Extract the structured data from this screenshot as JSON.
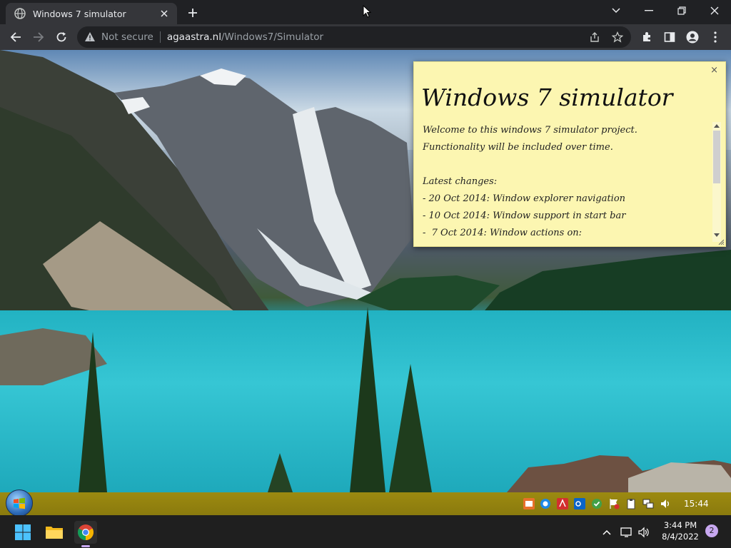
{
  "browser": {
    "tab_title": "Windows 7 simulator",
    "security_label": "Not secure",
    "url_host": "agaastra.nl",
    "url_path": "/Windows7/Simulator"
  },
  "note": {
    "close_label": "×",
    "title": "Windows 7 simulator",
    "lines": [
      "Welcome to this windows 7 simulator project.",
      "Functionality will be included over time.",
      "",
      "Latest changes:",
      "- 20 Oct 2014: Window explorer navigation",
      "- 10 Oct 2014: Window support in start bar",
      "-  7 Oct 2014: Window actions on:"
    ]
  },
  "w7_taskbar": {
    "clock": "15:44"
  },
  "w11_taskbar": {
    "time": "3:44 PM",
    "date": "8/4/2022",
    "notification_count": "2"
  },
  "colors": {
    "note_bg": "#fcf6b1",
    "w7_taskbar": "#9c8a10",
    "chrome_dark": "#202124"
  }
}
